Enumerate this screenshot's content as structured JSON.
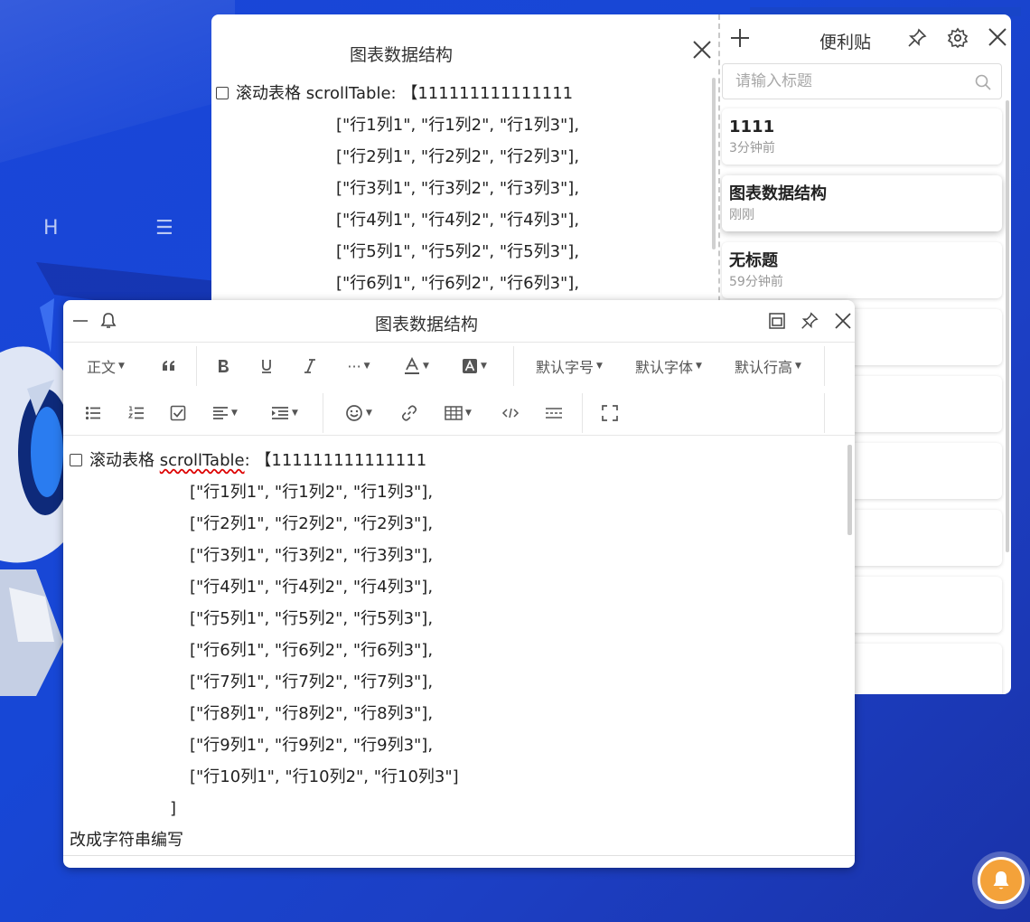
{
  "back_window": {
    "title": "图表数据结构",
    "lines": [
      "滚动表格 scrollTable: 【111111111111111",
      "[\"行1列1\", \"行1列2\", \"行1列3\"],",
      "[\"行2列1\", \"行2列2\", \"行2列3\"],",
      "[\"行3列1\", \"行3列2\", \"行3列3\"],",
      "[\"行4列1\", \"行4列2\", \"行4列3\"],",
      "[\"行5列1\", \"行5列2\", \"行5列3\"],",
      "[\"行6列1\", \"行6列2\", \"行6列3\"],"
    ]
  },
  "notes_panel": {
    "title": "便利贴",
    "search_placeholder": "请输入标题",
    "notes": [
      {
        "title": "1111",
        "time": "3分钟前"
      },
      {
        "title": "图表数据结构",
        "time": "刚刚"
      },
      {
        "title": "无标题",
        "time": "59分钟前"
      }
    ]
  },
  "editor": {
    "title": "图表数据结构",
    "toolbar": {
      "paragraph": "正文",
      "font_size": "默认字号",
      "font_family": "默认字体",
      "line_height": "默认行高",
      "more": "···"
    },
    "content": {
      "first_prefix": "滚动表格 ",
      "first_spell": "scrollTable",
      "first_suffix": ": 【111111111111111",
      "rows": [
        "[\"行1列1\", \"行1列2\", \"行1列3\"],",
        "[\"行2列1\", \"行2列2\", \"行2列3\"],",
        "[\"行3列1\", \"行3列2\", \"行3列3\"],",
        "[\"行4列1\", \"行4列2\", \"行4列3\"],",
        "[\"行5列1\", \"行5列2\", \"行5列3\"],",
        "[\"行6列1\", \"行6列2\", \"行6列3\"],",
        "[\"行7列1\", \"行7列2\", \"行7列3\"],",
        "[\"行8列1\", \"行8列2\", \"行8列3\"],",
        "[\"行9列1\", \"行9列2\", \"行9列3\"],",
        "[\"行10列1\", \"行10列2\", \"行10列3\"]"
      ],
      "closing": "]",
      "last_line": "改成字符串编写"
    }
  },
  "background": {
    "nav_letter": "H",
    "nav_menu": "☰"
  },
  "colors": {
    "accent_bell": "#f4a23a",
    "background": "#1a46d8"
  }
}
